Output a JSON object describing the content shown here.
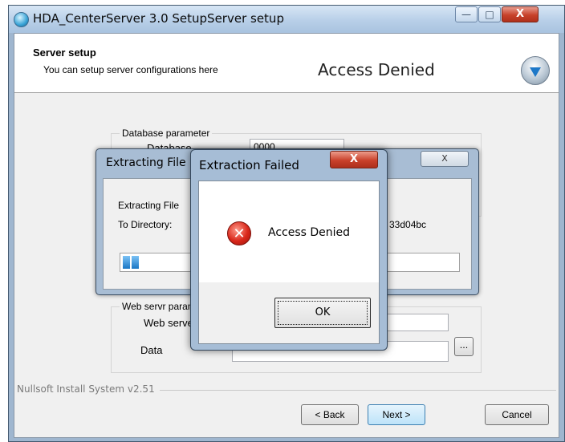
{
  "window": {
    "title": "HDA_CenterServer 3.0 SetupServer setup",
    "minimize_glyph": "—",
    "maximize_glyph": "□",
    "close_glyph": "X"
  },
  "header": {
    "title": "Server setup",
    "subtitle": "You can setup server configurations here",
    "status": "Access Denied"
  },
  "database_group": {
    "legend": "Database parameter",
    "first_label": "Database",
    "first_value": "0000"
  },
  "web_group": {
    "legend": "Web servr parameter",
    "server_label": "Web server",
    "data_label": "Data",
    "browse_label": "..."
  },
  "footer": {
    "branding": "Nullsoft Install System v2.51",
    "back": "< Back",
    "next": "Next >",
    "cancel": "Cancel"
  },
  "extract_dialog": {
    "title": "Extracting File",
    "close_glyph": "X",
    "extracting_label": "Extracting File",
    "directory_label": "To Directory:",
    "path_fragment": "33d04bc",
    "progress_percent": 4
  },
  "error_dialog": {
    "title": "Extraction Failed",
    "close_glyph": "X",
    "icon": "error-icon",
    "message": "Access Denied",
    "ok": "OK"
  },
  "colors": {
    "accent": "#1976c4",
    "error": "#d9271a"
  }
}
